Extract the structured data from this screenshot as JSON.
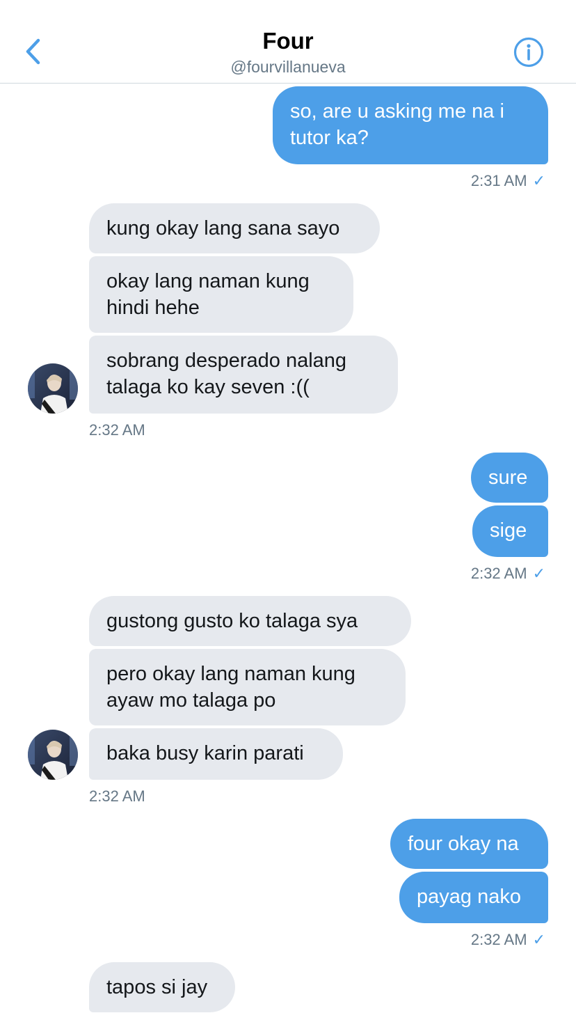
{
  "header": {
    "name": "Four",
    "handle": "@fourvillanueva"
  },
  "messages": {
    "m1": "so, are u asking me na i tutor ka?",
    "m1_line1": "so, are u asking me na i",
    "m1_line2": "tutor ka?",
    "ts1": "2:31 AM",
    "m2": "kung okay lang sana sayo",
    "m3_line1": "okay lang naman kung",
    "m3_line2": "hindi hehe",
    "m4_line1": "sobrang desperado nalang",
    "m4_line2": "talaga ko kay seven :((",
    "ts2": "2:32 AM",
    "m5": "sure",
    "m6": "sige",
    "ts3": "2:32 AM",
    "m7": "gustong gusto ko talaga sya",
    "m8_line1": "pero okay lang naman kung",
    "m8_line2": "ayaw mo talaga po",
    "m9": "baka busy karin parati",
    "ts4": "2:32 AM",
    "m10": "four okay na",
    "m11": "payag nako",
    "ts5": "2:32 AM",
    "m12": "tapos si jay"
  },
  "status": {
    "check": "✓"
  },
  "colors": {
    "accent": "#4d9fe8",
    "received_bubble": "#e6e9ee",
    "secondary_text": "#657786"
  },
  "icons": {
    "back": "chevron-left-icon",
    "info": "info-circle-icon",
    "read": "checkmark-icon"
  }
}
